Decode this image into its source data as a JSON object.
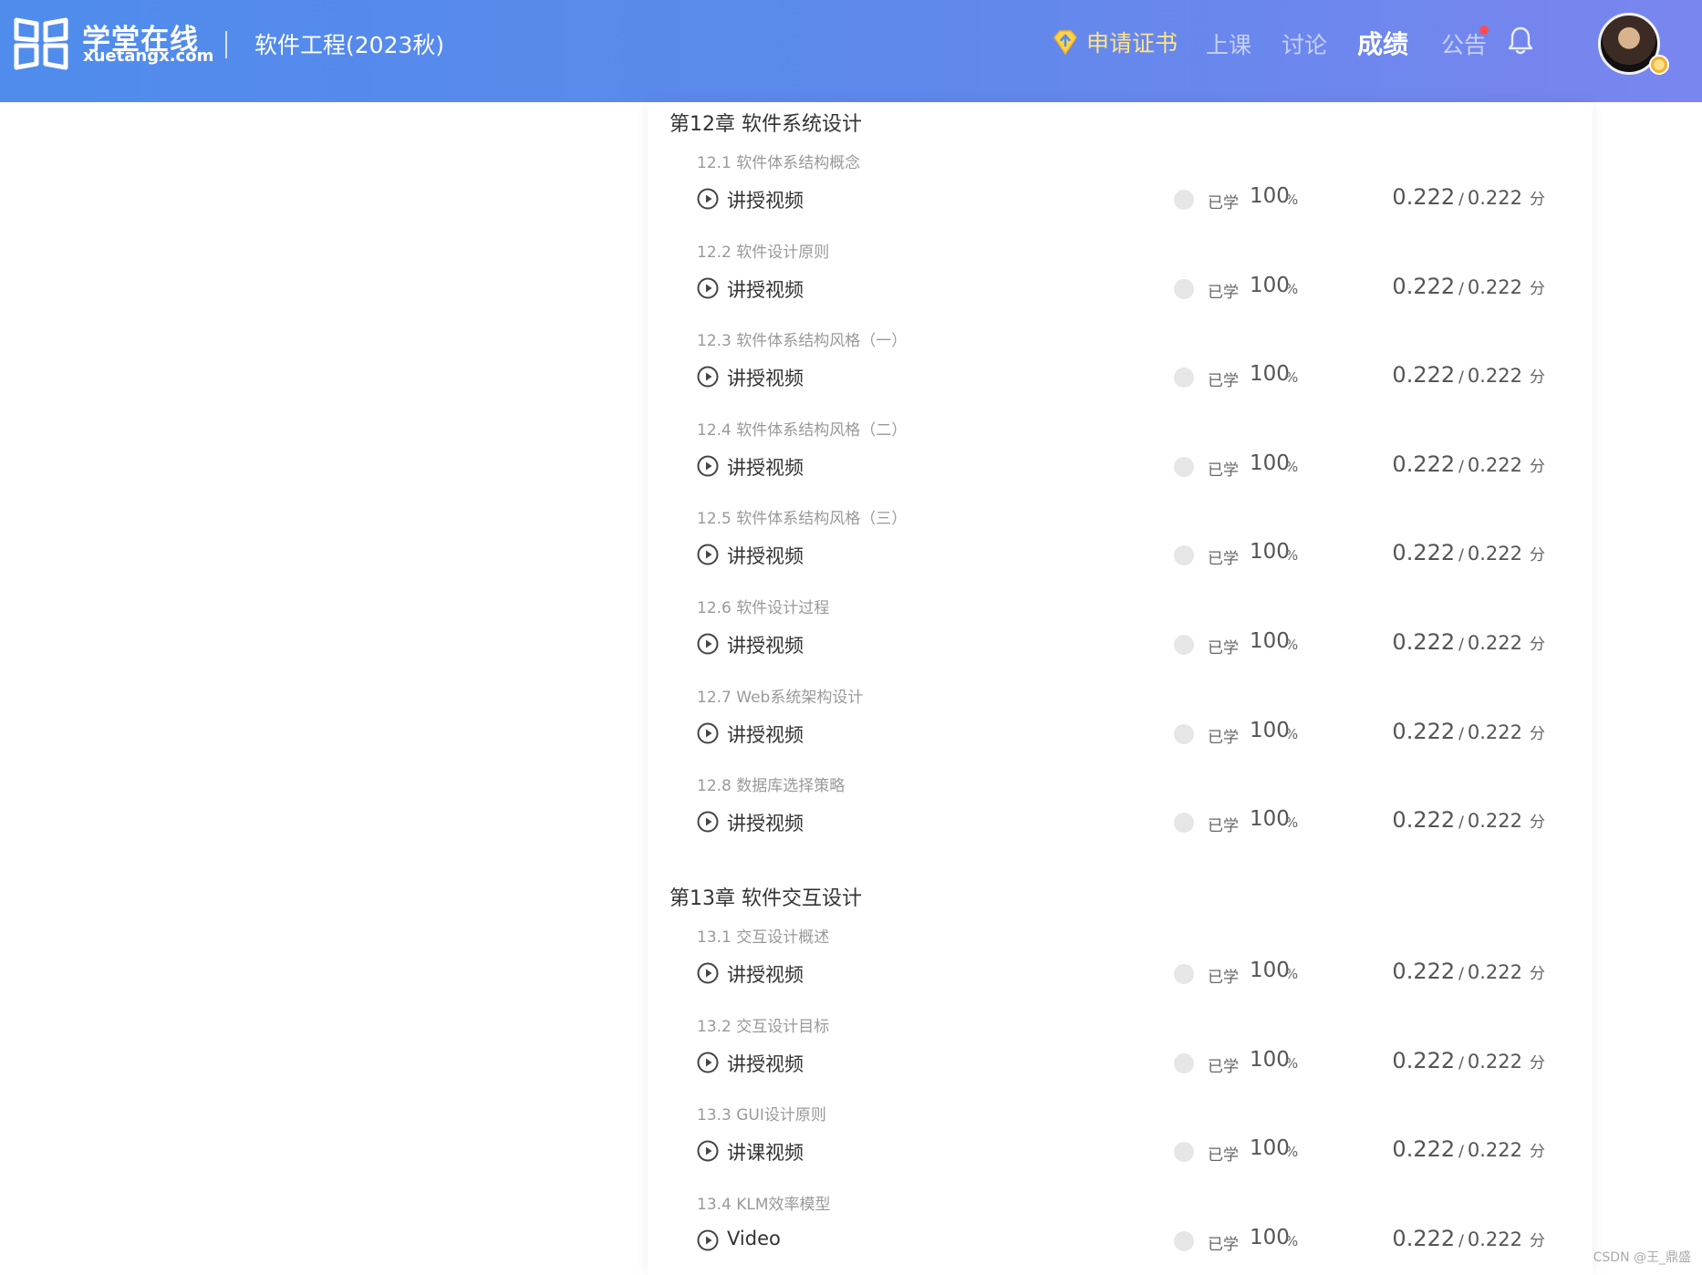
{
  "header": {
    "logo_cn": "学堂在线",
    "logo_en": "xuetangx.com",
    "course_title": "软件工程(2023秋)",
    "nav": {
      "certificate": "申请证书",
      "class": "上课",
      "discussion": "讨论",
      "grades": "成绩",
      "notice": "公告"
    },
    "active_tab": "成绩"
  },
  "chapters": [
    {
      "title": "第12章 软件系统设计",
      "sections": [
        {
          "title": "12.1 软件体系结构概念",
          "item": {
            "label": "讲授视频",
            "status": "已学",
            "percent": "100",
            "score": "0.222",
            "max": "0.222",
            "unit": "分"
          }
        },
        {
          "title": "12.2 软件设计原则",
          "item": {
            "label": "讲授视频",
            "status": "已学",
            "percent": "100",
            "score": "0.222",
            "max": "0.222",
            "unit": "分"
          }
        },
        {
          "title": "12.3 软件体系结构风格（一）",
          "item": {
            "label": "讲授视频",
            "status": "已学",
            "percent": "100",
            "score": "0.222",
            "max": "0.222",
            "unit": "分"
          }
        },
        {
          "title": "12.4 软件体系结构风格（二）",
          "item": {
            "label": "讲授视频",
            "status": "已学",
            "percent": "100",
            "score": "0.222",
            "max": "0.222",
            "unit": "分"
          }
        },
        {
          "title": "12.5 软件体系结构风格（三）",
          "item": {
            "label": "讲授视频",
            "status": "已学",
            "percent": "100",
            "score": "0.222",
            "max": "0.222",
            "unit": "分"
          }
        },
        {
          "title": "12.6 软件设计过程",
          "item": {
            "label": "讲授视频",
            "status": "已学",
            "percent": "100",
            "score": "0.222",
            "max": "0.222",
            "unit": "分"
          }
        },
        {
          "title": "12.7 Web系统架构设计",
          "item": {
            "label": "讲授视频",
            "status": "已学",
            "percent": "100",
            "score": "0.222",
            "max": "0.222",
            "unit": "分"
          }
        },
        {
          "title": "12.8 数据库选择策略",
          "item": {
            "label": "讲授视频",
            "status": "已学",
            "percent": "100",
            "score": "0.222",
            "max": "0.222",
            "unit": "分"
          }
        }
      ]
    },
    {
      "title": "第13章 软件交互设计",
      "sections": [
        {
          "title": "13.1 交互设计概述",
          "item": {
            "label": "讲授视频",
            "status": "已学",
            "percent": "100",
            "score": "0.222",
            "max": "0.222",
            "unit": "分"
          }
        },
        {
          "title": "13.2 交互设计目标",
          "item": {
            "label": "讲授视频",
            "status": "已学",
            "percent": "100",
            "score": "0.222",
            "max": "0.222",
            "unit": "分"
          }
        },
        {
          "title": "13.3 GUI设计原则",
          "item": {
            "label": "讲课视频",
            "status": "已学",
            "percent": "100",
            "score": "0.222",
            "max": "0.222",
            "unit": "分"
          }
        },
        {
          "title": "13.4 KLM效率模型",
          "item": {
            "label": "Video",
            "status": "已学",
            "percent": "100",
            "score": "0.222",
            "max": "0.222",
            "unit": "分"
          }
        }
      ]
    }
  ],
  "percent_sign": "%",
  "watermark": "CSDN @王_鼎盛"
}
